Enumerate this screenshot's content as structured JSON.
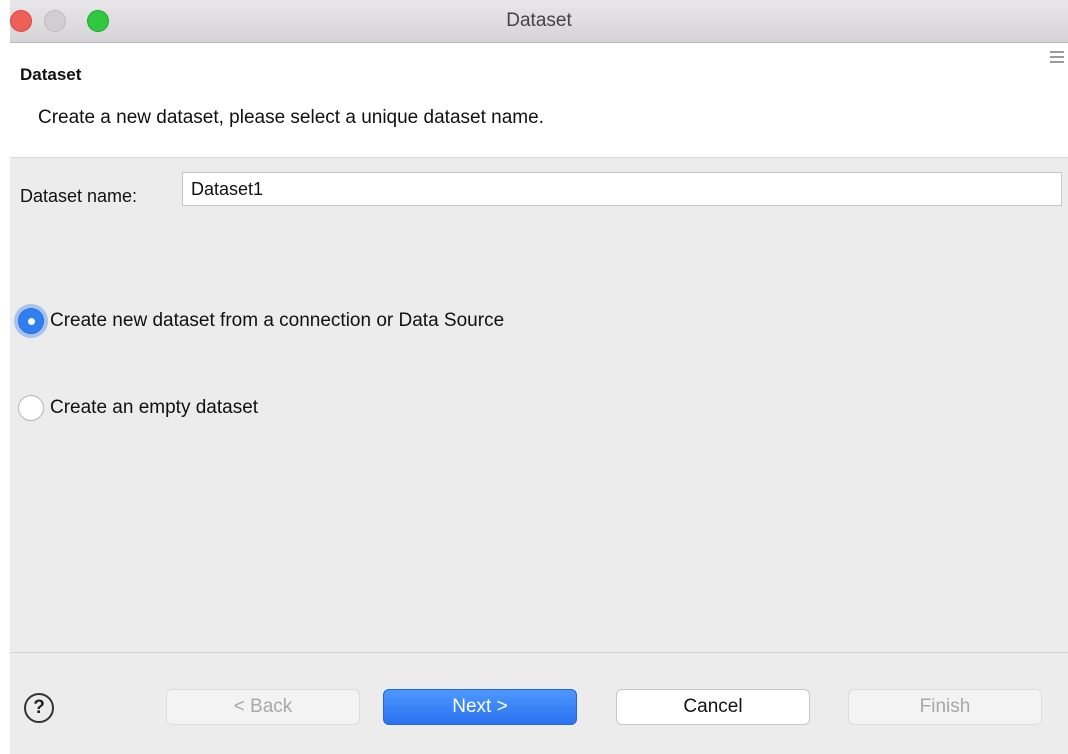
{
  "window": {
    "title": "Dataset"
  },
  "header": {
    "title": "Dataset",
    "description": "Create a new dataset, please select a unique dataset name."
  },
  "form": {
    "name_label": "Dataset name:",
    "name_value": "Dataset1",
    "options": [
      {
        "label": "Create new dataset from a connection or Data Source",
        "selected": true
      },
      {
        "label": "Create an empty dataset",
        "selected": false
      }
    ]
  },
  "footer": {
    "help_symbol": "?",
    "back_label": "< Back",
    "next_label": "Next >",
    "cancel_label": "Cancel",
    "finish_label": "Finish"
  },
  "colors": {
    "accent": "#2f7ff0",
    "close": "#ee5f57",
    "maximize": "#2fc840"
  }
}
